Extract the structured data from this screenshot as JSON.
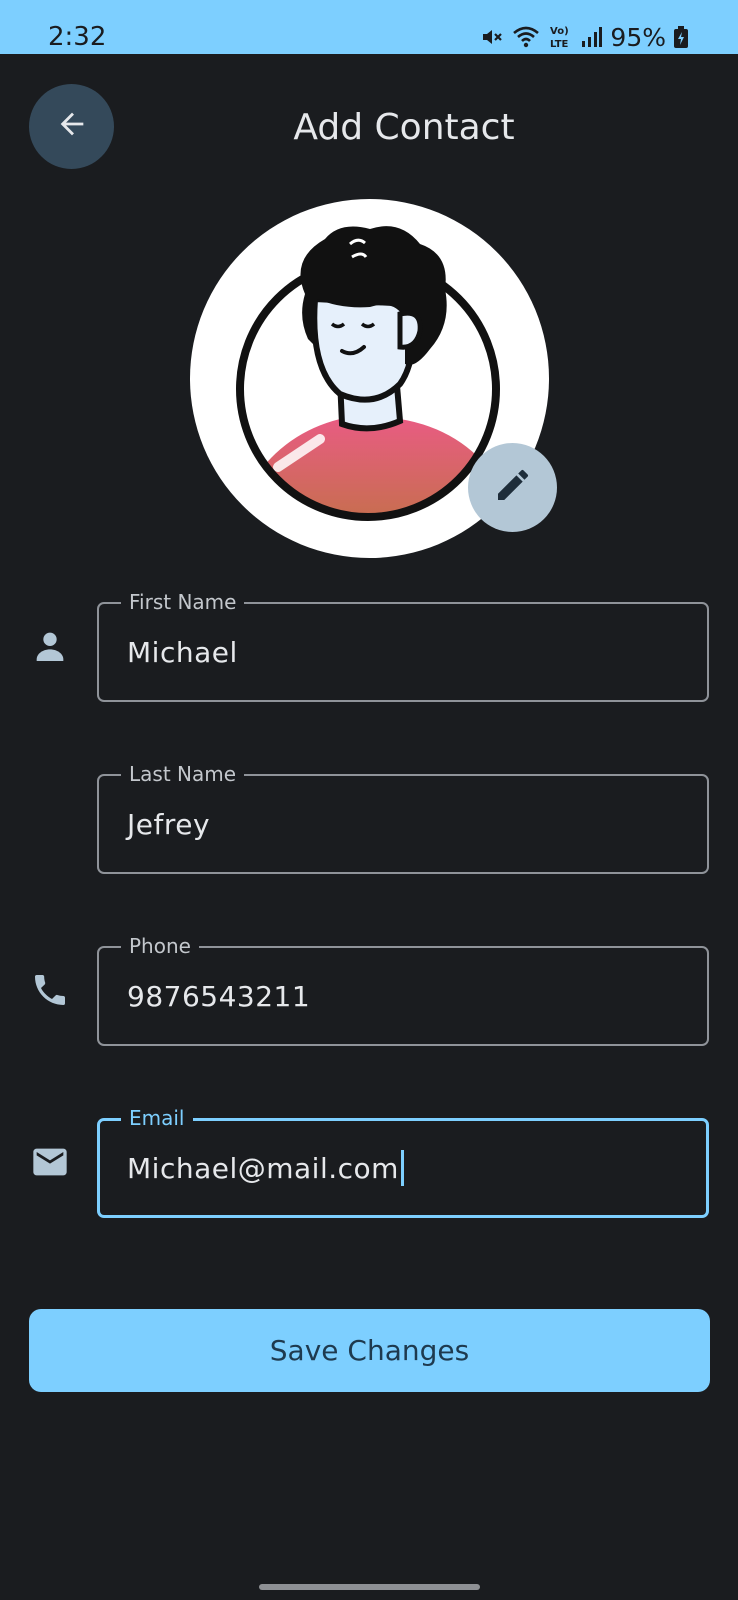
{
  "status_bar": {
    "time": "2:32",
    "battery": "95%",
    "network_label": "Vo) LTE"
  },
  "header": {
    "title": "Add Contact"
  },
  "form": {
    "first_name": {
      "label": "First Name",
      "value": "Michael"
    },
    "last_name": {
      "label": "Last Name",
      "value": "Jefrey"
    },
    "phone": {
      "label": "Phone",
      "value": "9876543211"
    },
    "email": {
      "label": "Email",
      "value": "Michael@mail.com"
    }
  },
  "actions": {
    "save_label": "Save Changes"
  },
  "colors": {
    "accent": "#7dcfff",
    "background": "#1a1c1f",
    "back_button": "#34495a",
    "edit_button": "#b3c7d6",
    "shirt": "#e35d7b"
  },
  "icons": [
    "mute-icon",
    "wifi-icon",
    "volte-icon",
    "signal-icon",
    "battery-icon",
    "back-arrow-icon",
    "pencil-icon",
    "person-icon",
    "phone-icon",
    "mail-icon"
  ]
}
